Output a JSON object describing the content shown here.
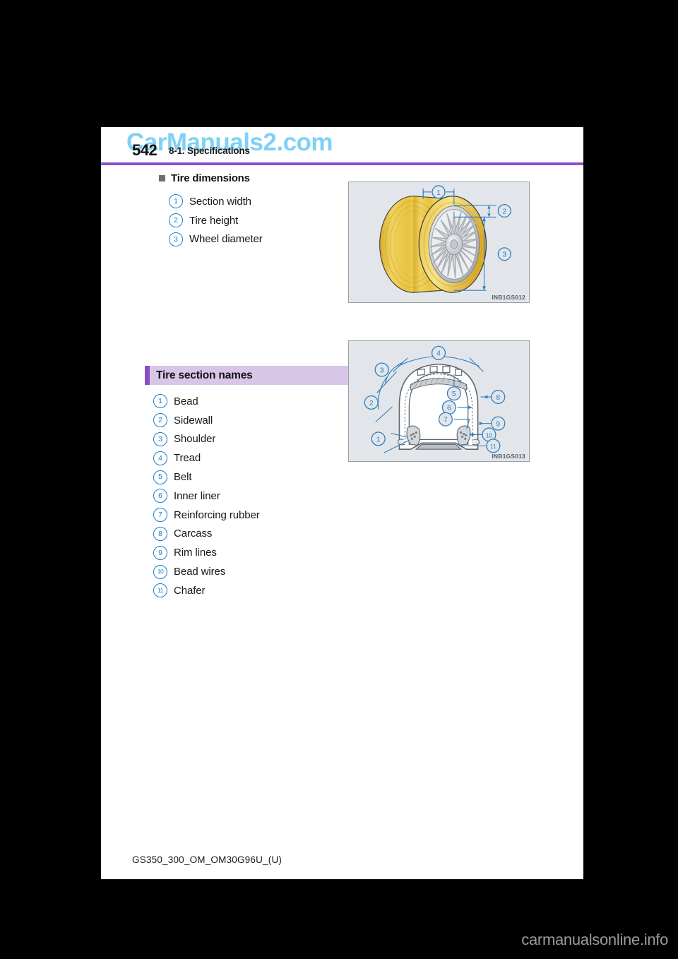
{
  "watermark": {
    "top_text": "CarManuals2.com",
    "bottom_text": "carmanualsonline.info"
  },
  "header": {
    "page_number": "542",
    "section_title": "8-1. Specifications",
    "rule_color": "#8b52c8"
  },
  "tire_dimensions": {
    "heading": "Tire dimensions",
    "bullet_color": "#6e6e6e",
    "items": [
      {
        "num": "1",
        "label": "Section width"
      },
      {
        "num": "2",
        "label": "Tire height"
      },
      {
        "num": "3",
        "label": "Wheel diameter"
      }
    ],
    "figure": {
      "code": "INB1GS012",
      "callouts": [
        "1",
        "2",
        "3"
      ],
      "tire_color": "#e8c23e",
      "wheel_color": "#c9ccd1",
      "background": "#e2e6ea"
    }
  },
  "tire_section_names": {
    "heading": "Tire section names",
    "band_background": "#d7c6e8",
    "band_accent": "#8b4fc0",
    "items": [
      {
        "num": "1",
        "label": "Bead"
      },
      {
        "num": "2",
        "label": "Sidewall"
      },
      {
        "num": "3",
        "label": "Shoulder"
      },
      {
        "num": "4",
        "label": "Tread"
      },
      {
        "num": "5",
        "label": "Belt"
      },
      {
        "num": "6",
        "label": "Inner liner"
      },
      {
        "num": "7",
        "label": "Reinforcing rubber"
      },
      {
        "num": "8",
        "label": "Carcass"
      },
      {
        "num": "9",
        "label": "Rim lines"
      },
      {
        "num": "10",
        "label": "Bead wires"
      },
      {
        "num": "11",
        "label": "Chafer"
      }
    ],
    "figure": {
      "code": "INB1GS013",
      "callouts": [
        "1",
        "2",
        "3",
        "4",
        "5",
        "6",
        "7",
        "8",
        "9",
        "10",
        "11"
      ],
      "line_color": "#2f7fbf",
      "background": "#e2e6ea"
    }
  },
  "footer": {
    "document_code": "GS350_300_OM_OM30G96U_(U)"
  },
  "accent_colors": {
    "callout_blue": "#1b7fc4",
    "rule_purple": "#8b52c8",
    "band_purple": "#d7c6e8"
  }
}
